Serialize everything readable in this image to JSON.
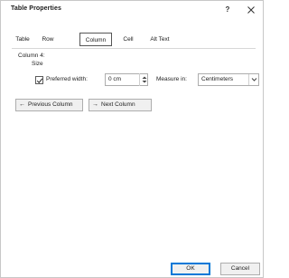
{
  "window": {
    "title": "Table Properties",
    "help": "?",
    "close_icon": "close-icon"
  },
  "tabs": [
    {
      "label": "Table",
      "active": false
    },
    {
      "label": "Row",
      "active": false
    },
    {
      "label": "Column",
      "active": true
    },
    {
      "label": "Cell",
      "active": false
    },
    {
      "label": "Alt Text",
      "active": false
    }
  ],
  "column": {
    "heading": "Column 4:",
    "size_label": "Size",
    "preferred_width": {
      "checked": true,
      "label": "Preferred width:",
      "value": "0 cm"
    },
    "measure_in": {
      "label": "Measure in:",
      "value": "Centimeters"
    }
  },
  "navigation": {
    "previous_label": "Previous Column",
    "next_label": "Next Column"
  },
  "footer": {
    "ok_label": "OK",
    "cancel_label": "Cancel"
  }
}
